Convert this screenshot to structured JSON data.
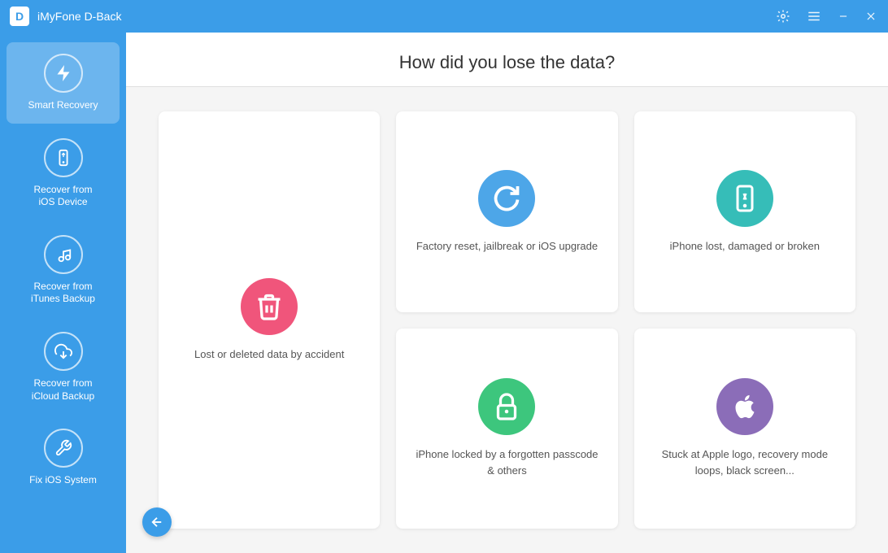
{
  "titlebar": {
    "logo": "D",
    "title": "iMyFone D-Back",
    "settings_label": "⚙",
    "menu_label": "☰",
    "minimize_label": "—",
    "close_label": "✕"
  },
  "sidebar": {
    "items": [
      {
        "id": "smart-recovery",
        "label": "Smart Recovery",
        "active": true,
        "icon": "lightning"
      },
      {
        "id": "recover-ios",
        "label": "Recover from\niOS Device",
        "active": false,
        "icon": "phone"
      },
      {
        "id": "recover-itunes",
        "label": "Recover from\niTunes Backup",
        "active": false,
        "icon": "music"
      },
      {
        "id": "recover-icloud",
        "label": "Recover from\niCloud Backup",
        "active": false,
        "icon": "cloud"
      },
      {
        "id": "fix-ios",
        "label": "Fix iOS System",
        "active": false,
        "icon": "wrench"
      }
    ]
  },
  "main": {
    "question": "How did you lose the data?",
    "cards": [
      {
        "id": "lost-deleted",
        "label": "Lost or deleted data by accident",
        "icon_bg": "#f0557b",
        "icon": "trash",
        "large": true
      },
      {
        "id": "factory-reset",
        "label": "Factory reset, jailbreak or iOS upgrade",
        "icon_bg": "#4da6e8",
        "icon": "refresh",
        "large": false
      },
      {
        "id": "iphone-lost",
        "label": "iPhone lost, damaged or broken",
        "icon_bg": "#36bdb8",
        "icon": "phone-broken",
        "large": false
      },
      {
        "id": "iphone-locked",
        "label": "iPhone locked by a forgotten passcode & others",
        "icon_bg": "#3dc67d",
        "icon": "lock",
        "large": false
      },
      {
        "id": "stuck-apple",
        "label": "Stuck at Apple logo, recovery mode loops, black screen...",
        "icon_bg": "#8b6db8",
        "icon": "apple",
        "large": false
      }
    ]
  },
  "back_button": "←"
}
